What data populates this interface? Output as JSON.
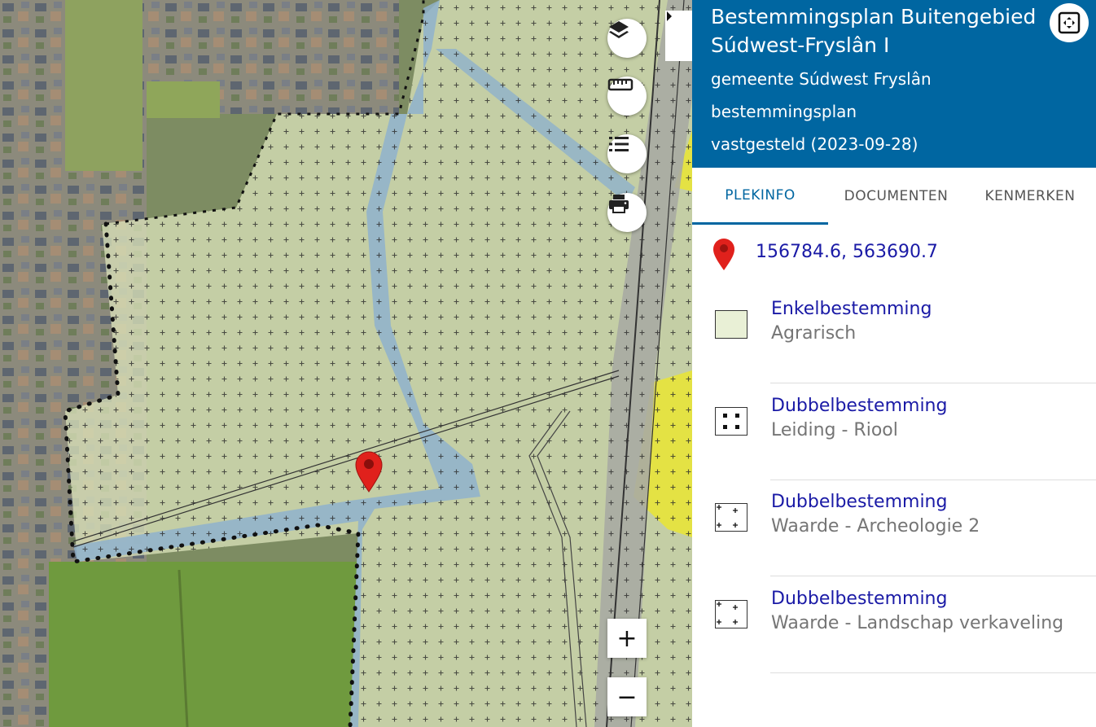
{
  "plan": {
    "title": "Bestemmingsplan Buitengebied Súdwest-Fryslân I",
    "municipality": "gemeente Súdwest Fryslân",
    "type": "bestemmingsplan",
    "status": "vastgesteld (2023-09-28)"
  },
  "tabs": [
    {
      "label": "PLEKINFO",
      "active": true
    },
    {
      "label": "DOCUMENTEN",
      "active": false
    },
    {
      "label": "KENMERKEN",
      "active": false
    }
  ],
  "location": {
    "coordinates": "156784.6, 563690.7",
    "icon": "map-pin-icon"
  },
  "entries": [
    {
      "title": "Enkelbestemming",
      "subtitle": "Agrarisch",
      "swatch": "agrarisch"
    },
    {
      "title": "Dubbelbestemming",
      "subtitle": "Leiding - Riool",
      "swatch": "dots"
    },
    {
      "title": "Dubbelbestemming",
      "subtitle": "Waarde - Archeologie 2",
      "swatch": "crosses"
    },
    {
      "title": "Dubbelbestemming",
      "subtitle": "Waarde - Landschap verkaveling",
      "swatch": "crosses"
    }
  ],
  "map_controls": {
    "layers_icon": "layers-icon",
    "measure_icon": "ruler-icon",
    "legend_icon": "list-icon",
    "print_icon": "printer-icon",
    "zoom_in_label": "+",
    "zoom_out_label": "−"
  },
  "colors": {
    "header": "#0066a1",
    "link": "#1a1aa6",
    "agrarisch": "#e9f0d6",
    "water": "#8fb2cc",
    "yellow_zone": "#e8e43a",
    "pin": "#e0211c"
  }
}
